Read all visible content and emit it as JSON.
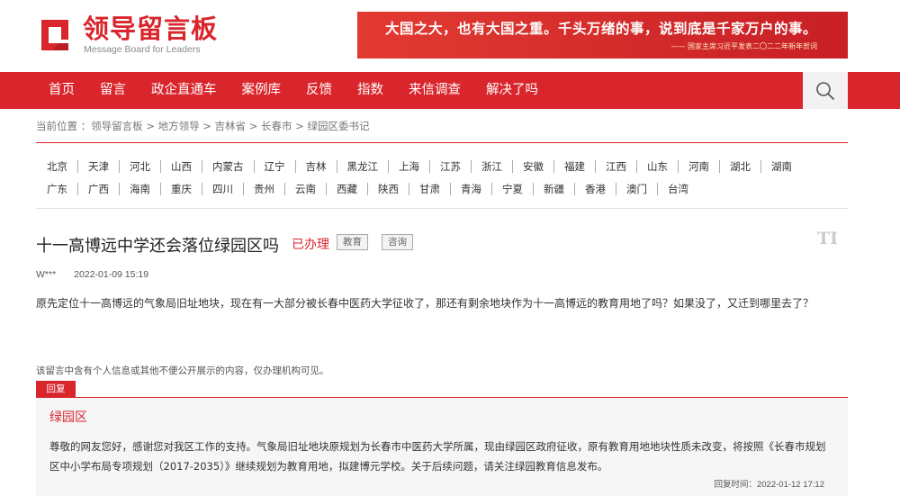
{
  "header": {
    "logo_title": "领导留言板",
    "logo_subtitle": "Message Board for Leaders",
    "banner_line1": "大国之大，也有大国之重。千头万绪的事，说到底是千家万户的事。",
    "banner_line2": "—— 国家主席习近平发表二〇二二年新年贺词"
  },
  "nav": {
    "items": [
      "首页",
      "留言",
      "政企直通车",
      "案例库",
      "反馈",
      "指数",
      "来信调查",
      "解决了吗"
    ],
    "search_icon": "search-icon"
  },
  "breadcrumb": {
    "label": "当前位置 ：",
    "path": "领导留言板 > 地方领导 > 吉林省 > 长春市 > 绿园区委书记"
  },
  "regions": {
    "row1": [
      "北京",
      "天津",
      "河北",
      "山西",
      "内蒙古",
      "辽宁",
      "吉林",
      "黑龙江",
      "上海",
      "江苏",
      "浙江",
      "安徽",
      "福建",
      "江西",
      "山东",
      "河南",
      "湖北",
      "湖南"
    ],
    "row2": [
      "广东",
      "广西",
      "海南",
      "重庆",
      "四川",
      "贵州",
      "云南",
      "西藏",
      "陕西",
      "甘肃",
      "青海",
      "宁夏",
      "新疆",
      "香港",
      "澳门",
      "台湾"
    ]
  },
  "post": {
    "title": "十一高博远中学还会落位绿园区吗",
    "status": "已办理",
    "tags": [
      "教育",
      "咨询"
    ],
    "corner_mark": "TI",
    "author": "W***",
    "date": "2022-01-09 15:19",
    "content": "原先定位十一高博远的气象局旧址地块，现在有一大部分被长春中医药大学征收了，那还有剩余地块作为十一高博远的教育用地了吗？如果没了，又迁到哪里去了？",
    "notice": "该留言中含有个人信息或其他不便公开展示的内容，仅办理机构可见。"
  },
  "reply": {
    "tab_label": "回复",
    "org": "绿园区",
    "text": "尊敬的网友您好，感谢您对我区工作的支持。气象局旧址地块原规划为长春市中医药大学所属，现由绿园区政府征收，原有教育用地地块性质未改变，将按照《长春市规划区中小学布局专项规划（2017-2035）》继续规划为教育用地，拟建博元学校。关于后续问题，请关注绿园教育信息发布。",
    "time_label": "回复时间：2022-01-12 17:12"
  },
  "colors": {
    "brand_red": "#d9262c"
  }
}
